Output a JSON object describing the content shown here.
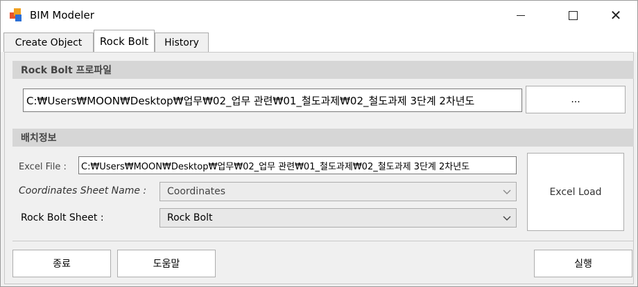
{
  "window": {
    "title": "BIM Modeler",
    "close_glyph": "✕"
  },
  "tabs": [
    {
      "label": "Create Object",
      "active": false
    },
    {
      "label": "Rock Bolt",
      "active": true
    },
    {
      "label": "History",
      "active": false
    }
  ],
  "profile": {
    "header": "Rock Bolt 프로파일",
    "path": "C:₩Users₩MOON₩Desktop₩업무₩02_업무 관련₩01_철도과제₩02_철도과제 3단계 2차년도",
    "browse_label": "..."
  },
  "layout": {
    "header": "배치정보",
    "excel_file_label": "Excel File :",
    "excel_file_path": "C:₩Users₩MOON₩Desktop₩업무₩02_업무 관련₩01_철도과제₩02_철도과제 3단계 2차년도",
    "coord_sheet_label": "Coordinates Sheet Name :",
    "coord_sheet_value": "Coordinates",
    "rock_sheet_label": "Rock Bolt Sheet :",
    "rock_sheet_value": "Rock Bolt",
    "excel_load_label": "Excel Load"
  },
  "footer": {
    "exit_label": "종료",
    "help_label": "도움말",
    "run_label": "실행"
  },
  "colors": {
    "section_header_bg": "#d6d6d6",
    "window_bg": "#f0f0f0",
    "icon_orange": "#e8542b",
    "icon_yellow": "#f0a020",
    "icon_blue": "#2b6fd6"
  }
}
